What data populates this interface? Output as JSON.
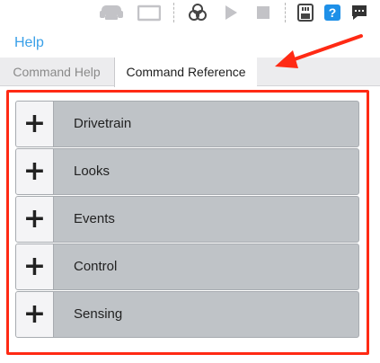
{
  "panel": {
    "title": "Help",
    "tabs": [
      {
        "label": "Command Help",
        "active": false
      },
      {
        "label": "Command Reference",
        "active": true
      }
    ]
  },
  "categories": [
    {
      "label": "Drivetrain",
      "expander": "+"
    },
    {
      "label": "Looks",
      "expander": "+"
    },
    {
      "label": "Events",
      "expander": "+"
    },
    {
      "label": "Control",
      "expander": "+"
    },
    {
      "label": "Sensing",
      "expander": "+"
    }
  ],
  "toolbar": {
    "icons": [
      "robot-icon",
      "screen-icon",
      "blocks-icon",
      "play-icon",
      "stop-icon",
      "device-icon",
      "help-icon",
      "chat-icon"
    ],
    "help_glyph": "?"
  },
  "colors": {
    "accent": "#3aa0e8",
    "highlight": "#ff2a14",
    "category_bg": "#bfc3c7"
  }
}
